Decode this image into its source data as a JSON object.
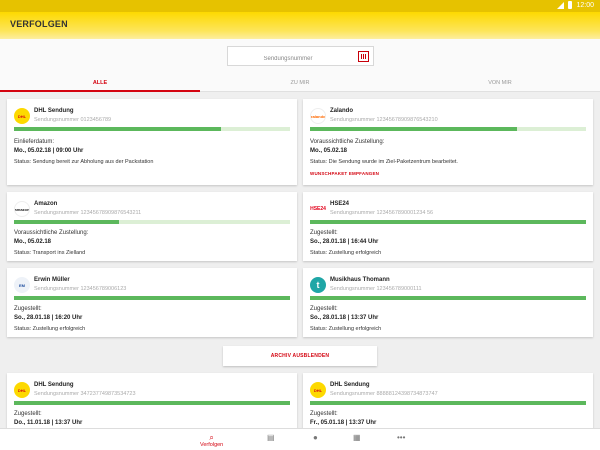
{
  "statusbar": {
    "time": "12:00"
  },
  "appbar": {
    "title": "VERFOLGEN"
  },
  "search": {
    "placeholder": "Sendungsnummer"
  },
  "tabs": [
    "ALLE",
    "ZU MIR",
    "VON MIR"
  ],
  "cards": [
    {
      "sender": "DHL Sendung",
      "tracking": "Sendungsnummer 0123456789",
      "progress": 0.75,
      "label": "Einlieferdatum:",
      "date": "Mo., 05.02.18 | 09:00 Uhr",
      "status": "Status: Sendung bereit zur Abholung aus der Packstation",
      "logo": "DHL"
    },
    {
      "sender": "Zalando",
      "tracking": "Sendungsnummer 12345678909876543210",
      "progress": 0.75,
      "label": "Voraussichtliche Zustellung:",
      "date": "Mo., 05.02.18",
      "status": "Status: Die Sendung wurde im Ziel-Paketzentrum bearbeitet.",
      "link": "WUNSCHPAKET EMPFANGEN",
      "logo": "zalando"
    },
    {
      "sender": "Amazon",
      "tracking": "Sendungsnummer 12345678909876543211",
      "progress": 0.38,
      "label": "Voraussichtliche Zustellung:",
      "date": "Mo., 05.02.18",
      "status": "Status: Transport ins Zielland",
      "logo": "amazon"
    },
    {
      "sender": "HSE24",
      "tracking": "Sendungsnummer 1234567890001234 56",
      "progress": 1.0,
      "label": "Zugestellt:",
      "date": "So., 28.01.18 | 16:44 Uhr",
      "status": "Status: Zustellung erfolgreich",
      "logo": "HSE24"
    },
    {
      "sender": "Erwin Müller",
      "tracking": "Sendungsnummer 123456789006123",
      "progress": 1.0,
      "label": "Zugestellt:",
      "date": "So., 28.01.18 | 16:20 Uhr",
      "status": "Status: Zustellung erfolgreich",
      "logo": "EM"
    },
    {
      "sender": "Musikhaus Thomann",
      "tracking": "Sendungsnummer 123456789000111",
      "progress": 1.0,
      "label": "Zugestellt:",
      "date": "So., 28.01.18 | 13:37 Uhr",
      "status": "Status: Zustellung erfolgreich",
      "logo": "t"
    },
    {
      "sender": "DHL Sendung",
      "tracking": "Sendungsnummer 347237749873534723",
      "progress": 1.0,
      "label": "Zugestellt:",
      "date": "Do., 11.01.18 | 13:37 Uhr",
      "status": "",
      "logo": "DHL"
    },
    {
      "sender": "DHL Sendung",
      "tracking": "Sendungsnummer 88888124398734873747",
      "progress": 1.0,
      "label": "Zugestellt:",
      "date": "Fr., 05.01.18 | 13:37 Uhr",
      "status": "",
      "logo": "DHL"
    }
  ],
  "archive_button": "ARCHIV AUSBLENDEN",
  "bottomnav": {
    "active_label": "Verfolgen"
  },
  "colors": {
    "accent": "#d40511",
    "brand_yellow": "#fdd900",
    "progress": "#5cb85c"
  }
}
